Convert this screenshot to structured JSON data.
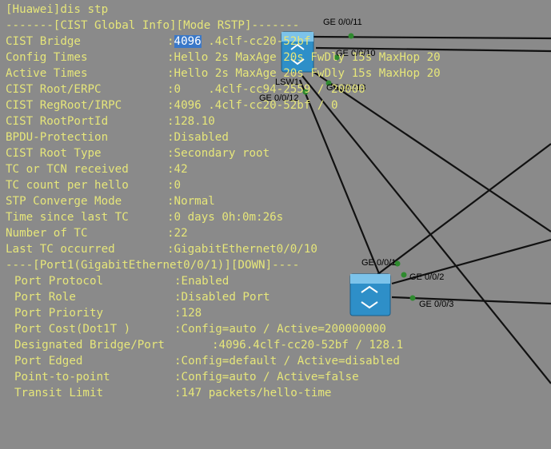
{
  "prompt": "[Huawei]dis stp",
  "cist_header": "-------[CIST Global Info][Mode RSTP]-------",
  "global_info": [
    {
      "label": "CIST Bridge",
      "value_highlight": "4096",
      "value": " .4clf-cc20-52bf"
    },
    {
      "label": "Config Times",
      "value": ":Hello 2s MaxAge 20s FwDly 15s MaxHop 20"
    },
    {
      "label": "Active Times",
      "value": ":Hello 2s MaxAge 20s FwDly 15s MaxHop 20"
    },
    {
      "label": "CIST Root/ERPC",
      "value": ":0    .4clf-cc94-2559 / 20000"
    },
    {
      "label": "CIST RegRoot/IRPC",
      "value": ":4096 .4clf-cc20-52bf / 0"
    },
    {
      "label": "CIST RootPortId",
      "value": ":128.10"
    },
    {
      "label": "BPDU-Protection",
      "value": ":Disabled"
    },
    {
      "label": "CIST Root Type",
      "value": ":Secondary root"
    },
    {
      "label": "TC or TCN received",
      "value": ":42"
    },
    {
      "label": "TC count per hello",
      "value": ":0"
    },
    {
      "label": "STP Converge Mode",
      "value": ":Normal"
    },
    {
      "label": "Time since last TC",
      "value": ":0 days 0h:0m:26s"
    },
    {
      "label": "Number of TC",
      "value": ":22"
    },
    {
      "label": "Last TC occurred",
      "value": ":GigabitEthernet0/0/10"
    }
  ],
  "port_header": "----[Port1(GigabitEthernet0/0/1)][DOWN]----",
  "port_info": [
    {
      "label": "Port Protocol",
      "value": ":Enabled"
    },
    {
      "label": "Port Role",
      "value": ":Disabled Port"
    },
    {
      "label": "Port Priority",
      "value": ":128"
    },
    {
      "label": "Port Cost(Dot1T )",
      "value": ":Config=auto / Active=200000000"
    },
    {
      "label": "Designated Bridge/Port",
      "value": ":4096.4clf-cc20-52bf / 128.1"
    },
    {
      "label": "Port Edged",
      "value": ":Config=default / Active=disabled"
    },
    {
      "label": "Point-to-point",
      "value": ":Config=auto / Active=false"
    },
    {
      "label": "Transit Limit",
      "value": ":147 packets/hello-time"
    }
  ],
  "topology": {
    "switch_top_name": "LSW1",
    "switch_top_ports": [
      "GE 0/0/11",
      "GE 0/0/10",
      "GE 0/0/13",
      "GE 0/0/12"
    ],
    "switch_bottom_ports": [
      "GE 0/0/1",
      "GE 0/0/2",
      "GE 0/0/3"
    ]
  },
  "colors": {
    "terminal_text": "#e6e67a",
    "highlight_bg": "#3a78c8",
    "port_dot": "#2f8a2f",
    "switch_blue": "#2e8fc8"
  }
}
